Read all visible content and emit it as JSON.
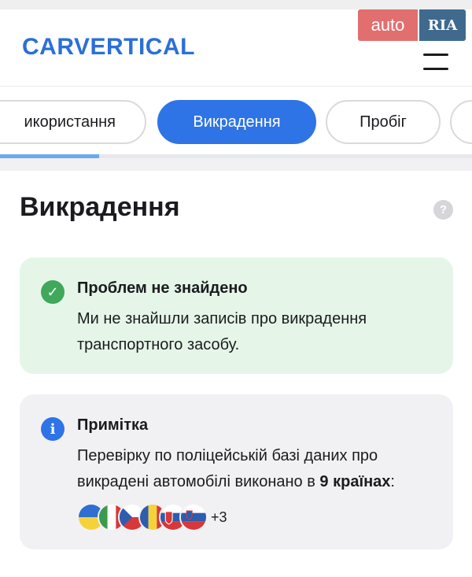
{
  "header": {
    "logo": "CARVERTICAL",
    "auto_label": "auto",
    "ria_label": "RIA"
  },
  "tabs": [
    {
      "label": "икористання",
      "active": false
    },
    {
      "label": "Викрадення",
      "active": true
    },
    {
      "label": "Пробіг",
      "active": false
    }
  ],
  "progress": {
    "value": 0.21
  },
  "section": {
    "title": "Викрадення",
    "help": "?"
  },
  "status_card": {
    "icon": "check-circle-icon",
    "title": "Проблем не знайдено",
    "text": "Ми не знайшли записів про викрадення транспортного засобу."
  },
  "note_card": {
    "icon": "info-icon",
    "title": "Примітка",
    "text_before": "Перевірку по поліцейській базі даних про викрадені автомобілі виконано в ",
    "countries_bold": "9 країнах",
    "text_after": ":",
    "flags": [
      "ukraine-flag-icon",
      "italy-flag-icon",
      "czechia-flag-icon",
      "romania-flag-icon",
      "slovakia-flag-icon",
      "slovenia-flag-icon"
    ],
    "more": "+3"
  },
  "colors": {
    "brand": "#2b6fd8",
    "tab_active": "#2f74e6",
    "success_bg": "#e5f6e8",
    "success_icon": "#3fa85a",
    "info_icon": "#2f74e6"
  }
}
